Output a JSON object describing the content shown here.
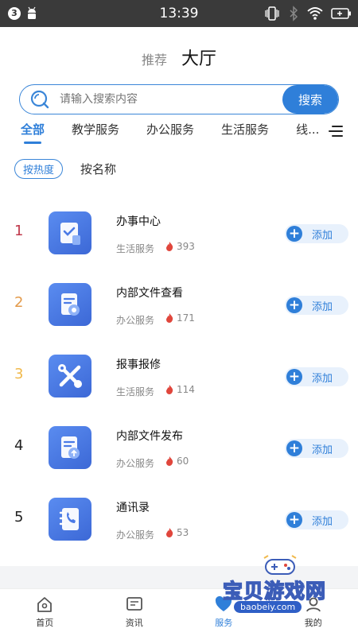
{
  "status_bar": {
    "badge": "3",
    "time": "13:39"
  },
  "header": {
    "tabs": [
      {
        "label": "推荐"
      },
      {
        "label": "大厅"
      }
    ]
  },
  "search": {
    "placeholder": "请输入搜索内容",
    "button_label": "搜索"
  },
  "categories": [
    {
      "label": "全部"
    },
    {
      "label": "教学服务"
    },
    {
      "label": "办公服务"
    },
    {
      "label": "生活服务"
    },
    {
      "label": "线..."
    }
  ],
  "sort": {
    "options": [
      {
        "label": "按热度"
      },
      {
        "label": "按名称"
      }
    ]
  },
  "services": [
    {
      "rank": "1",
      "rank_color": "#c0394b",
      "name": "办事中心",
      "category": "生活服务",
      "heat": "393",
      "add_label": "添加",
      "icon": "checklist-icon"
    },
    {
      "rank": "2",
      "rank_color": "#e39a4a",
      "name": "内部文件查看",
      "category": "办公服务",
      "heat": "171",
      "add_label": "添加",
      "icon": "document-view-icon"
    },
    {
      "rank": "3",
      "rank_color": "#f0b94c",
      "name": "报事报修",
      "category": "生活服务",
      "heat": "114",
      "add_label": "添加",
      "icon": "repair-tools-icon"
    },
    {
      "rank": "4",
      "rank_color": "#222222",
      "name": "内部文件发布",
      "category": "办公服务",
      "heat": "60",
      "add_label": "添加",
      "icon": "document-upload-icon"
    },
    {
      "rank": "5",
      "rank_color": "#222222",
      "name": "通讯录",
      "category": "办公服务",
      "heat": "53",
      "add_label": "添加",
      "icon": "contacts-book-icon"
    }
  ],
  "tabbar": {
    "tabs": [
      {
        "label": "首页",
        "icon": "home-icon"
      },
      {
        "label": "资讯",
        "icon": "news-icon"
      },
      {
        "label": "服务",
        "icon": "heart-service-icon"
      },
      {
        "label": "我的",
        "icon": "profile-icon"
      }
    ]
  },
  "watermark": {
    "text": "宝贝游戏网",
    "url": "baobeiy.com"
  },
  "colors": {
    "accent": "#2f7fd9",
    "icon_gradient_start": "#5a8cf0",
    "icon_gradient_end": "#3c68d6",
    "heat_flame": "#e0463c"
  }
}
